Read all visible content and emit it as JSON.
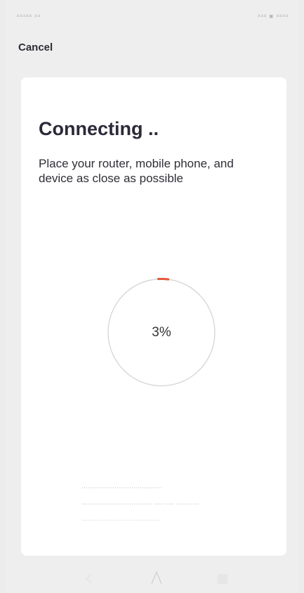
{
  "status_bar": {
    "left_text": "ᵃᵃᵃᵃᵃ ᵃᵃ",
    "right_text": "ᵃᵃᵃ ■ ᵃᵃᵃᵃ"
  },
  "nav": {
    "cancel_label": "Cancel"
  },
  "card": {
    "heading": "Connecting ..",
    "instruction": "Place your router, mobile phone, and device as close as possible",
    "progress_text": "3%",
    "progress_fraction": 0.03,
    "accent_color": "#e2583a",
    "ring_color": "#d8d8d8",
    "tip_lines": [
      "·······································",
      "·································· ···· ····· ···········",
      "······································"
    ]
  },
  "bottom_nav": {
    "back_icon": "back-icon",
    "home_icon": "home-icon",
    "recent_icon": "recent-apps-icon"
  }
}
